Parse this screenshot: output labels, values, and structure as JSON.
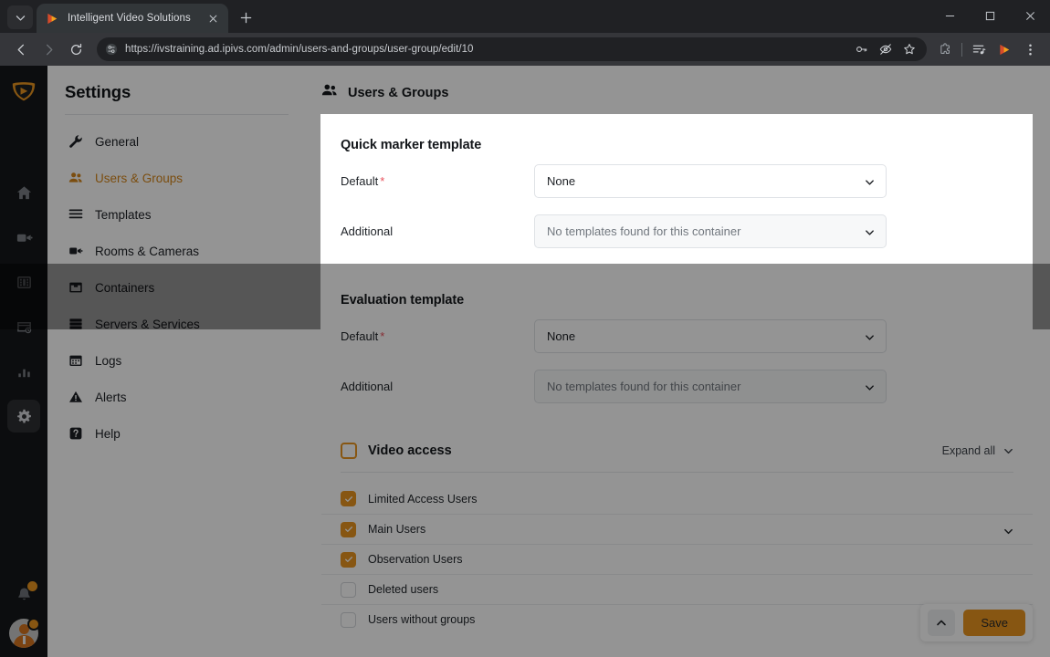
{
  "browser": {
    "tab": {
      "title": "Intelligent Video Solutions",
      "favicon_name": "ipivs-play-favicon",
      "close_label": "×"
    },
    "new_tab_label": "+",
    "tab_list_icon": "chevron-down-icon",
    "nav": {
      "back": "back-icon",
      "forward": "forward-icon",
      "reload": "reload-icon"
    },
    "omnibox": {
      "url": "https://ivstraining.ad.ipivs.com/admin/users-and-groups/user-group/edit/10",
      "site_info_icon": "site-settings-icon",
      "icons": [
        "password-key-icon",
        "eye-slash-icon",
        "bookmark-star-icon"
      ]
    },
    "toolbar_icons": [
      "extensions-puzzle-icon",
      "reading-list-icon",
      "ipivs-profile-icon",
      "chrome-menu-icon"
    ],
    "window_controls": [
      "minimize",
      "maximize",
      "close"
    ]
  },
  "rail": {
    "logo_name": "ipivs-shield-logo",
    "items": [
      {
        "name": "home-icon",
        "label": "Home",
        "active": false
      },
      {
        "name": "camera-icon",
        "label": "Live",
        "active": false
      },
      {
        "name": "film-icon",
        "label": "Recordings",
        "active": false
      },
      {
        "name": "archive-clock-icon",
        "label": "Archive",
        "active": false
      },
      {
        "name": "bar-chart-icon",
        "label": "Reports",
        "active": false
      },
      {
        "name": "gear-icon",
        "label": "Settings",
        "active": true
      }
    ],
    "bell_icon": "bell-icon",
    "bell_has_badge": true,
    "avatar_name": "user-avatar",
    "avatar_has_badge": true
  },
  "settings": {
    "title": "Settings",
    "items": [
      {
        "label": "General",
        "icon": "wrench-icon",
        "active": false
      },
      {
        "label": "Users & Groups",
        "icon": "users-icon",
        "active": true
      },
      {
        "label": "Templates",
        "icon": "list-icon",
        "active": false
      },
      {
        "label": "Rooms & Cameras",
        "icon": "video-camera-icon",
        "active": false
      },
      {
        "label": "Containers",
        "icon": "box-icon",
        "active": false
      },
      {
        "label": "Servers & Services",
        "icon": "server-icon",
        "active": false
      },
      {
        "label": "Logs",
        "icon": "calendar-icon",
        "active": false
      },
      {
        "label": "Alerts",
        "icon": "warning-icon",
        "active": false
      },
      {
        "label": "Help",
        "icon": "help-icon",
        "active": false
      }
    ]
  },
  "main": {
    "header": {
      "title": "Users & Groups",
      "icon": "users-icon"
    },
    "quick_marker": {
      "title": "Quick marker template",
      "default_label": "Default",
      "default_required": "*",
      "default_value": "None",
      "additional_label": "Additional",
      "additional_value": "No templates found for this container"
    },
    "evaluation": {
      "title": "Evaluation template",
      "default_label": "Default",
      "default_required": "*",
      "default_value": "None",
      "additional_label": "Additional",
      "additional_value": "No templates found for this container"
    },
    "video_access": {
      "title": "Video access",
      "header_checkbox": "unchecked-outline",
      "expand_all_label": "Expand all",
      "rows": [
        {
          "label": "Limited Access Users",
          "checked": true,
          "expandable": false
        },
        {
          "label": "Main Users",
          "checked": true,
          "expandable": true
        },
        {
          "label": "Observation Users",
          "checked": true,
          "expandable": false
        },
        {
          "label": "Deleted users",
          "checked": false,
          "expandable": false
        },
        {
          "label": "Users without groups",
          "checked": false,
          "expandable": false
        }
      ]
    },
    "save_bar": {
      "scroll_top_icon": "chevron-up-icon",
      "save_label": "Save"
    }
  },
  "colors": {
    "accent_orange": "#e8951f",
    "required_red": "#e8505b",
    "active_nav": "#d4861a",
    "chrome_dark": "#202124",
    "toolbar_dark": "#35363a"
  }
}
